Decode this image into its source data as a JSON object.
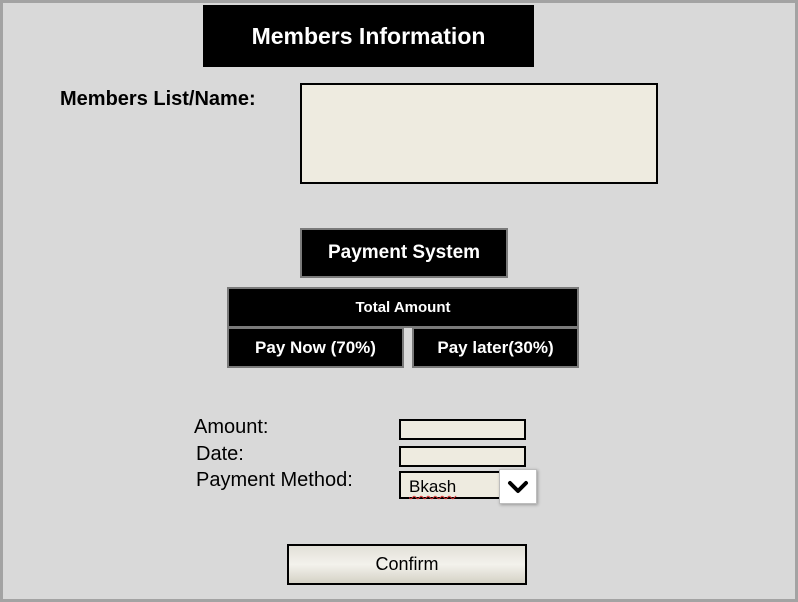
{
  "header": {
    "title": "Members Information"
  },
  "members": {
    "label": "Members List/Name:",
    "value": ""
  },
  "payment": {
    "system_label": "Payment System",
    "total_label": "Total Amount",
    "pay_now_label": "Pay Now (70%)",
    "pay_later_label": "Pay later(30%)"
  },
  "form": {
    "amount_label": "Amount:",
    "amount_value": "",
    "date_label": "Date:",
    "date_value": "",
    "method_label": "Payment Method:",
    "method_value": "Bkash",
    "method_icon": "chevron-down-icon"
  },
  "actions": {
    "confirm_label": "Confirm"
  }
}
